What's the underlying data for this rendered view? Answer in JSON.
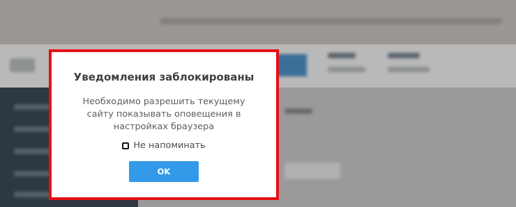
{
  "dialog": {
    "title": "Уведомления заблокированы",
    "message": "Необходимо разрешить текущему сайту показывать оповещения в настройках браузера",
    "checkbox": {
      "label": "Не напоминать",
      "checked": false
    },
    "ok_button_label": "OK"
  },
  "colors": {
    "highlight_border": "#e60f14",
    "ok_button": "#329ae8",
    "title_text": "#404040",
    "message_text": "#5d5d5d"
  }
}
